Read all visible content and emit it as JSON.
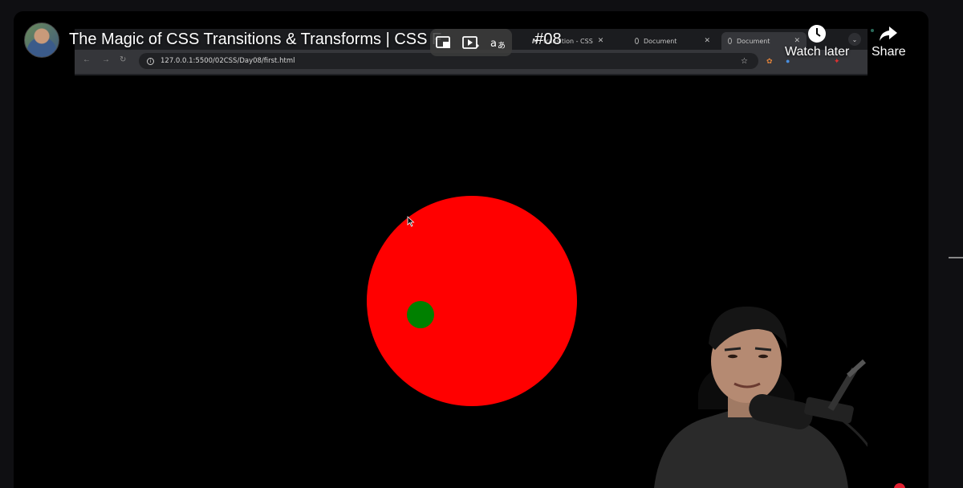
{
  "video": {
    "title": "The Magic of CSS Transitions & Transforms | CSS F",
    "title_end": "#08",
    "actions": {
      "watch_later": "Watch later",
      "share": "Share"
    }
  },
  "recorded_browser": {
    "tabs": [
      {
        "label": "transition - CSS",
        "icon": "mdn-icon"
      },
      {
        "label": "Document",
        "icon": "globe-icon"
      },
      {
        "label": "Document",
        "icon": "globe-icon",
        "active": true
      }
    ],
    "url": "127.0.0.1:5500/02CSS/Day08/first.html"
  },
  "stage": {
    "colors": {
      "background": "#000000",
      "big_circle": "#ff0000",
      "small_circle": "#008000"
    }
  }
}
